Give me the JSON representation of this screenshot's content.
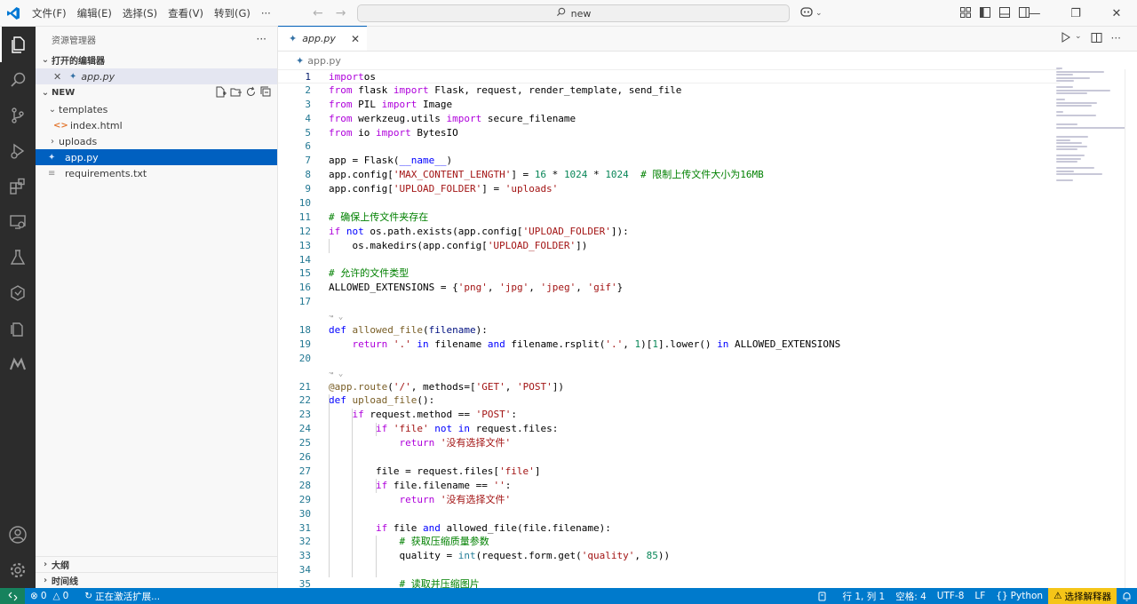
{
  "menu": [
    "文件(F)",
    "编辑(E)",
    "选择(S)",
    "查看(V)",
    "转到(G)",
    "···"
  ],
  "search": {
    "text": "new"
  },
  "sidebar": {
    "title": "资源管理器",
    "more": "···",
    "open_editors_label": "打开的编辑器",
    "open_editors": [
      {
        "name": "app.py"
      }
    ],
    "workspace_label": "NEW",
    "tree": [
      {
        "name": "templates",
        "type": "folder",
        "expanded": true,
        "depth": 1
      },
      {
        "name": "index.html",
        "type": "html",
        "depth": 2
      },
      {
        "name": "uploads",
        "type": "folder",
        "expanded": false,
        "depth": 1
      },
      {
        "name": "app.py",
        "type": "python",
        "depth": 1,
        "selected": true
      },
      {
        "name": "requirements.txt",
        "type": "text",
        "depth": 1
      }
    ],
    "outline_label": "大纲",
    "timeline_label": "时间线"
  },
  "editor": {
    "tab_label": "app.py",
    "breadcrumb": "app.py"
  },
  "code": [
    {
      "n": "1",
      "t": [
        [
          "kw",
          "import"
        ],
        [
          "",
          "os"
        ]
      ]
    },
    {
      "n": "2",
      "t": [
        [
          "kw",
          "from"
        ],
        [
          "",
          " flask "
        ],
        [
          "kw",
          "import"
        ],
        [
          "",
          " Flask, request, render_template, send_file"
        ]
      ]
    },
    {
      "n": "3",
      "t": [
        [
          "kw",
          "from"
        ],
        [
          "",
          " PIL "
        ],
        [
          "kw",
          "import"
        ],
        [
          "",
          " Image"
        ]
      ]
    },
    {
      "n": "4",
      "t": [
        [
          "kw",
          "from"
        ],
        [
          "",
          " werkzeug.utils "
        ],
        [
          "kw",
          "import"
        ],
        [
          "",
          " secure_filename"
        ]
      ]
    },
    {
      "n": "5",
      "t": [
        [
          "kw",
          "from"
        ],
        [
          "",
          " io "
        ],
        [
          "kw",
          "import"
        ],
        [
          "",
          " BytesIO"
        ]
      ]
    },
    {
      "n": "6",
      "t": []
    },
    {
      "n": "7",
      "t": [
        [
          "",
          "app = Flask("
        ],
        [
          "kb",
          "__name__"
        ],
        [
          "",
          ")"
        ]
      ]
    },
    {
      "n": "8",
      "t": [
        [
          "",
          "app.config["
        ],
        [
          "st",
          "'MAX_CONTENT_LENGTH'"
        ],
        [
          "",
          "] = "
        ],
        [
          "nm",
          "16"
        ],
        [
          "",
          " * "
        ],
        [
          "nm",
          "1024"
        ],
        [
          "",
          " * "
        ],
        [
          "nm",
          "1024"
        ],
        [
          "",
          "  "
        ],
        [
          "cm",
          "# 限制上传文件大小为16MB"
        ]
      ]
    },
    {
      "n": "9",
      "t": [
        [
          "",
          "app.config["
        ],
        [
          "st",
          "'UPLOAD_FOLDER'"
        ],
        [
          "",
          "] = "
        ],
        [
          "st",
          "'uploads'"
        ]
      ]
    },
    {
      "n": "10",
      "t": []
    },
    {
      "n": "11",
      "t": [
        [
          "cm",
          "# 确保上传文件夹存在"
        ]
      ]
    },
    {
      "n": "12",
      "t": [
        [
          "kw",
          "if"
        ],
        [
          "",
          " "
        ],
        [
          "kb",
          "not"
        ],
        [
          "",
          " os.path.exists(app.config["
        ],
        [
          "st",
          "'UPLOAD_FOLDER'"
        ],
        [
          "",
          "]):"
        ]
      ]
    },
    {
      "n": "13",
      "t": [
        [
          "",
          "    os.makedirs(app.config["
        ],
        [
          "st",
          "'UPLOAD_FOLDER'"
        ],
        [
          "",
          "])"
        ]
      ]
    },
    {
      "n": "14",
      "t": []
    },
    {
      "n": "15",
      "t": [
        [
          "cm",
          "# 允许的文件类型"
        ]
      ]
    },
    {
      "n": "16",
      "t": [
        [
          "",
          "ALLOWED_EXTENSIONS = {"
        ],
        [
          "st",
          "'png'"
        ],
        [
          "",
          ", "
        ],
        [
          "st",
          "'jpg'"
        ],
        [
          "",
          ", "
        ],
        [
          "st",
          "'jpeg'"
        ],
        [
          "",
          ", "
        ],
        [
          "st",
          "'gif'"
        ],
        [
          "",
          "}"
        ]
      ]
    },
    {
      "n": "17",
      "t": []
    },
    {
      "n": "",
      "lens": true
    },
    {
      "n": "18",
      "t": [
        [
          "kb",
          "def"
        ],
        [
          "",
          " "
        ],
        [
          "fn",
          "allowed_file"
        ],
        [
          "",
          "("
        ],
        [
          "pa",
          "filename"
        ],
        [
          "",
          "):"
        ]
      ]
    },
    {
      "n": "19",
      "t": [
        [
          "",
          "    "
        ],
        [
          "kw",
          "return"
        ],
        [
          "",
          " "
        ],
        [
          "st",
          "'.'"
        ],
        [
          "",
          " "
        ],
        [
          "kb",
          "in"
        ],
        [
          "",
          " filename "
        ],
        [
          "kb",
          "and"
        ],
        [
          "",
          " filename.rsplit("
        ],
        [
          "st",
          "'.'"
        ],
        [
          "",
          ", "
        ],
        [
          "nm",
          "1"
        ],
        [
          "",
          ")["
        ],
        [
          "nm",
          "1"
        ],
        [
          "",
          "].lower() "
        ],
        [
          "kb",
          "in"
        ],
        [
          "",
          " ALLOWED_EXTENSIONS"
        ]
      ]
    },
    {
      "n": "20",
      "t": []
    },
    {
      "n": "",
      "lens": true
    },
    {
      "n": "21",
      "t": [
        [
          "dc",
          "@app.route"
        ],
        [
          "",
          "("
        ],
        [
          "st",
          "'/'"
        ],
        [
          "",
          ", methods=["
        ],
        [
          "st",
          "'GET'"
        ],
        [
          "",
          ", "
        ],
        [
          "st",
          "'POST'"
        ],
        [
          "",
          "])"
        ]
      ]
    },
    {
      "n": "22",
      "t": [
        [
          "kb",
          "def"
        ],
        [
          "",
          " "
        ],
        [
          "fn",
          "upload_file"
        ],
        [
          "",
          "():"
        ]
      ]
    },
    {
      "n": "23",
      "t": [
        [
          "",
          "    "
        ],
        [
          "kw",
          "if"
        ],
        [
          "",
          " request.method == "
        ],
        [
          "st",
          "'POST'"
        ],
        [
          "",
          ":"
        ]
      ]
    },
    {
      "n": "24",
      "t": [
        [
          "",
          "        "
        ],
        [
          "kw",
          "if"
        ],
        [
          "",
          " "
        ],
        [
          "st",
          "'file'"
        ],
        [
          "",
          " "
        ],
        [
          "kb",
          "not"
        ],
        [
          "",
          " "
        ],
        [
          "kb",
          "in"
        ],
        [
          "",
          " request.files:"
        ]
      ]
    },
    {
      "n": "25",
      "t": [
        [
          "",
          "            "
        ],
        [
          "kw",
          "return"
        ],
        [
          "",
          " "
        ],
        [
          "st",
          "'没有选择文件'"
        ]
      ]
    },
    {
      "n": "26",
      "t": []
    },
    {
      "n": "27",
      "t": [
        [
          "",
          "        file = request.files["
        ],
        [
          "st",
          "'file'"
        ],
        [
          "",
          "]"
        ]
      ]
    },
    {
      "n": "28",
      "t": [
        [
          "",
          "        "
        ],
        [
          "kw",
          "if"
        ],
        [
          "",
          " file.filename == "
        ],
        [
          "st",
          "''"
        ],
        [
          "",
          ":"
        ]
      ]
    },
    {
      "n": "29",
      "t": [
        [
          "",
          "            "
        ],
        [
          "kw",
          "return"
        ],
        [
          "",
          " "
        ],
        [
          "st",
          "'没有选择文件'"
        ]
      ]
    },
    {
      "n": "30",
      "t": []
    },
    {
      "n": "31",
      "t": [
        [
          "",
          "        "
        ],
        [
          "kw",
          "if"
        ],
        [
          "",
          " file "
        ],
        [
          "kb",
          "and"
        ],
        [
          "",
          " allowed_file(file.filename):"
        ]
      ]
    },
    {
      "n": "32",
      "t": [
        [
          "",
          "            "
        ],
        [
          "cm",
          "# 获取压缩质量参数"
        ]
      ]
    },
    {
      "n": "33",
      "t": [
        [
          "",
          "            quality = "
        ],
        [
          "ty",
          "int"
        ],
        [
          "",
          "(request.form.get("
        ],
        [
          "st",
          "'quality'"
        ],
        [
          "",
          ", "
        ],
        [
          "nm",
          "85"
        ],
        [
          "",
          "))"
        ]
      ]
    },
    {
      "n": "34",
      "t": []
    },
    {
      "n": "35",
      "t": [
        [
          "",
          "            "
        ],
        [
          "cm",
          "# 读取并压缩图片"
        ]
      ]
    }
  ],
  "status": {
    "errors": "0",
    "warnings": "0",
    "activating": "正在激活扩展...",
    "position": "行 1, 列 1",
    "spaces": "空格: 4",
    "encoding": "UTF-8",
    "eol": "LF",
    "language": "Python",
    "interpreter": "选择解释器"
  },
  "colors": {
    "accent": "#007acc",
    "selection": "#0060c0",
    "activity_bar": "#2c2c2c",
    "warning": "#f5c518"
  }
}
